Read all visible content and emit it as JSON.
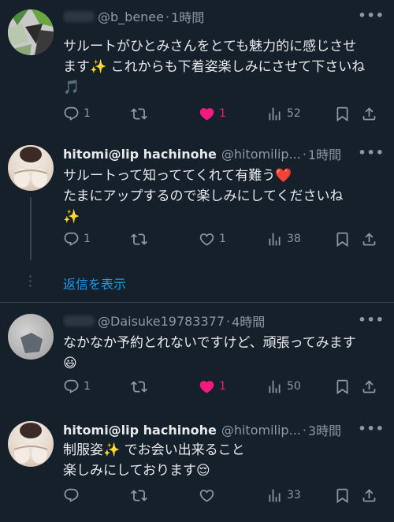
{
  "tweets": [
    {
      "handle": "@b_benee",
      "time": "1時間",
      "line1": "サルートがひとみさんをとても魅力的に感じさせ",
      "line2": "ます✨ これからも下着姿楽しみにさせて下さいね",
      "line3": "🎵",
      "replies": "1",
      "likes": "1",
      "views": "52"
    },
    {
      "name": "hitomi@lip hachinohe",
      "handle": "@hitomilip...",
      "time": "1時間",
      "line1": "サルートって知っててくれて有難う❤️",
      "line2": "たまにアップするので楽しみにしてくださいね",
      "line3": "✨",
      "replies": "1",
      "likes": "1",
      "views": "38"
    },
    {
      "handle": "@Daisuke19783377",
      "time": "4時間",
      "line1": "なかなか予約とれないですけど、頑張ってみます",
      "line2": "😃",
      "replies": "1",
      "likes": "1",
      "views": "50"
    },
    {
      "name": "hitomi@lip hachinohe",
      "handle": "@hitomilip...",
      "time": "3時間",
      "line1": "制服姿✨ でお会い出来ること",
      "line2": "楽しみにしております😌",
      "views": "33"
    }
  ],
  "show_replies": "返信を表示",
  "sep": "·",
  "icons": [
    "reply-icon",
    "retweet-icon",
    "like-icon",
    "views-icon",
    "bookmark-icon",
    "share-icon",
    "more-icon"
  ],
  "colors": {
    "background": "#15202b",
    "text": "#e7e9ea",
    "muted": "#8b98a5",
    "link": "#1d9bf0",
    "like": "#f91880"
  }
}
